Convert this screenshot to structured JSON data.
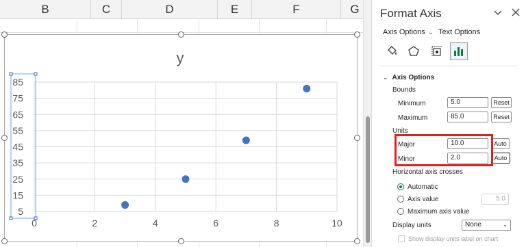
{
  "sheet": {
    "columns": [
      "B",
      "C",
      "D",
      "E",
      "F",
      "G"
    ]
  },
  "chart_data": {
    "type": "scatter",
    "title": "y",
    "x": [
      3,
      5,
      7,
      9
    ],
    "y": [
      9,
      25,
      49,
      81
    ],
    "xlim": [
      0,
      10
    ],
    "ylim": [
      5,
      85
    ],
    "x_ticks": [
      "0",
      "2",
      "4",
      "6",
      "8",
      "10"
    ],
    "y_ticks": [
      "85",
      "75",
      "65",
      "55",
      "45",
      "35",
      "25",
      "15",
      "5"
    ],
    "grid": true,
    "marker_color": "#4472c4"
  },
  "pane": {
    "title": "Format Axis",
    "tabs": {
      "axis_options": "Axis Options",
      "text_options": "Text Options"
    },
    "icons": [
      "fill-line-icon",
      "effects-icon",
      "size-properties-icon",
      "axis-options-icon"
    ],
    "section_title": "Axis Options",
    "bounds": {
      "label": "Bounds",
      "minimum_label": "Minimum",
      "minimum_value": "5.0",
      "maximum_label": "Maximum",
      "maximum_value": "85.0",
      "reset_label": "Reset"
    },
    "units": {
      "label": "Units",
      "major_label": "Major",
      "major_value": "10.0",
      "minor_label": "Minor",
      "minor_value": "2.0",
      "auto_label": "Auto"
    },
    "crosses": {
      "label": "Horizontal axis crosses",
      "automatic": "Automatic",
      "axis_value": "Axis value",
      "axis_value_input": "5.0",
      "maximum": "Maximum axis value"
    },
    "display_units": {
      "label": "Display units",
      "value": "None"
    },
    "show_units_label": "Show display units label on chart"
  },
  "colors": {
    "accent": "#107c41",
    "highlight": "#e02020",
    "marker": "#4472c4"
  }
}
